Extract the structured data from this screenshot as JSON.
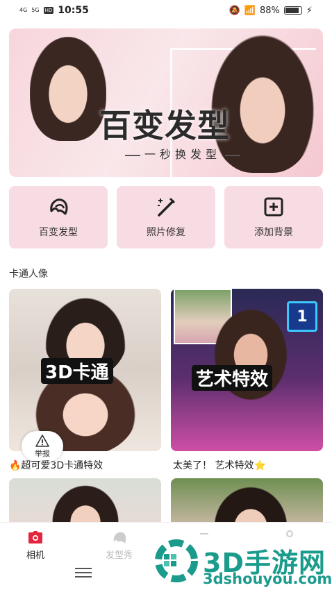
{
  "status_bar": {
    "signal1": "4G",
    "signal2": "5G",
    "hd": "HD",
    "time": "10:55",
    "battery": "88%",
    "battery_level": 0.88
  },
  "banner": {
    "title": "百变发型",
    "subtitle": "一秒换发型",
    "page_count": 4,
    "active_index": 1
  },
  "tools": [
    {
      "label": "百变发型",
      "icon": "hair-icon"
    },
    {
      "label": "照片修复",
      "icon": "magic-wand-icon"
    },
    {
      "label": "添加背景",
      "icon": "add-box-icon"
    }
  ],
  "section": {
    "title": "卡通人像"
  },
  "cards": [
    {
      "tag": "3D卡通",
      "caption": "🔥超可爱3D卡通特效"
    },
    {
      "tag": "艺术特效",
      "caption": "太美了！ 艺术特效⭐"
    }
  ],
  "report": {
    "label": "举报"
  },
  "nav": [
    {
      "label": "相机",
      "icon": "camera-icon",
      "active": true
    },
    {
      "label": "发型秀",
      "icon": "hair-show-icon",
      "active": false
    }
  ],
  "watermark": {
    "text": "3D手游网",
    "url": "3dshouyou.com"
  },
  "colors": {
    "accent": "#e46b8f",
    "tile_bg": "#f8dce3",
    "watermark": "#1a9b8c"
  }
}
